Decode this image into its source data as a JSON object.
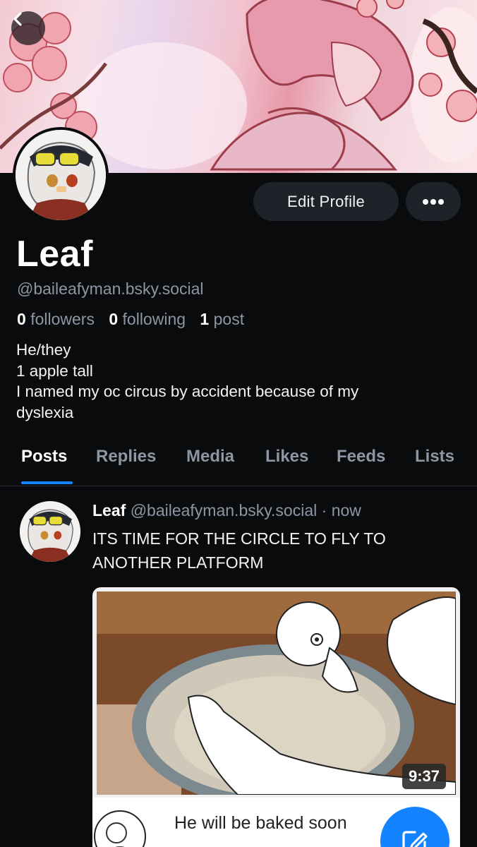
{
  "profile": {
    "display_name": "Leaf",
    "handle": "@baileafyman.bsky.social",
    "followers_count": "0",
    "followers_label": "followers",
    "following_count": "0",
    "following_label": "following",
    "posts_count": "1",
    "posts_label": "post",
    "bio_lines": [
      "He/they",
      "1 apple tall",
      "I named my oc circus by accident because of my",
      "dyslexia"
    ]
  },
  "actions": {
    "edit_profile_label": "Edit Profile",
    "back_icon": "chevron-left-icon",
    "more_icon": "ellipsis-icon"
  },
  "tabs": [
    {
      "label": "Posts",
      "active": true
    },
    {
      "label": "Replies",
      "active": false
    },
    {
      "label": "Media",
      "active": false
    },
    {
      "label": "Likes",
      "active": false
    },
    {
      "label": "Feeds",
      "active": false
    },
    {
      "label": "Lists",
      "active": false
    }
  ],
  "post": {
    "author_name": "Leaf",
    "author_handle": "@baileafyman.bsky.social",
    "separator": "·",
    "time": "now",
    "text_lines": [
      "ITS TIME FOR THE CIRCLE TO FLY TO",
      "ANOTHER PLATFORM"
    ],
    "embed": {
      "duration": "9:37",
      "title": "He will be baked soon"
    }
  },
  "colors": {
    "background": "#0a0b0d",
    "accent": "#1383ff",
    "muted_text": "#8d96a3",
    "button_bg": "#1e2229"
  },
  "fab": {
    "icon": "compose-icon"
  }
}
